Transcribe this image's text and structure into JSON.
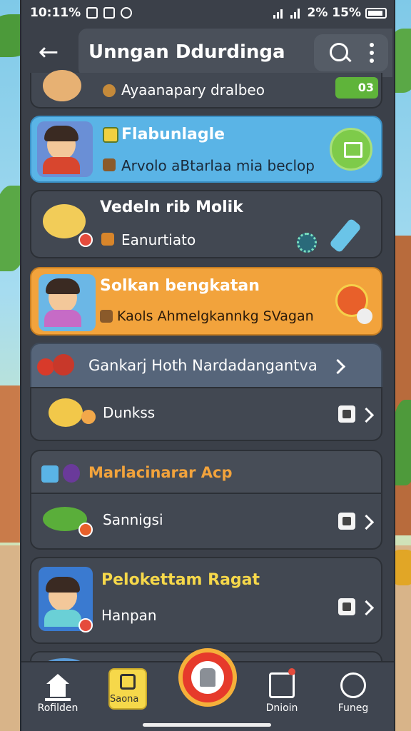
{
  "status_bar": {
    "time": "10:11%",
    "battery": "2% 15%"
  },
  "header": {
    "title": "Unngan Ddurdinga"
  },
  "rows": [
    {
      "title": "",
      "subtitle": "Ayaanapary dralbeo",
      "badge": "03"
    },
    {
      "title": "Flabunlagle",
      "subtitle": "Arvolo aBtarlaa mia beclop"
    },
    {
      "title": "Vedeln rib Molik",
      "subtitle": "Eanurtiato"
    },
    {
      "title": "Solkan bengkatan",
      "subtitle": "Kaols Ahmelgkannkg SVagan"
    },
    {
      "title": "Gankarj Hoth Nardadangantva"
    },
    {
      "title": "Dunkss"
    },
    {
      "title": "Marlacinarar Acp"
    },
    {
      "title": "Sannigsi"
    },
    {
      "title": "Pelokettam Ragat",
      "subtitle": "Hanpan"
    }
  ],
  "nav": {
    "items": [
      {
        "label": "Rofilden"
      },
      {
        "label": "Saona"
      },
      {
        "label": ""
      },
      {
        "label": "Dnioin"
      },
      {
        "label": "Funeg"
      }
    ]
  },
  "colors": {
    "panel": "#3b4049",
    "card_blue": "#5ab4e6",
    "card_orange": "#f2a33c",
    "accent_yellow": "#f6d84a"
  },
  "icons": [
    "back-arrow-icon",
    "search-icon",
    "more-vert-icon",
    "home-icon",
    "bookmark-icon",
    "notification-icon",
    "search-globe-icon"
  ]
}
